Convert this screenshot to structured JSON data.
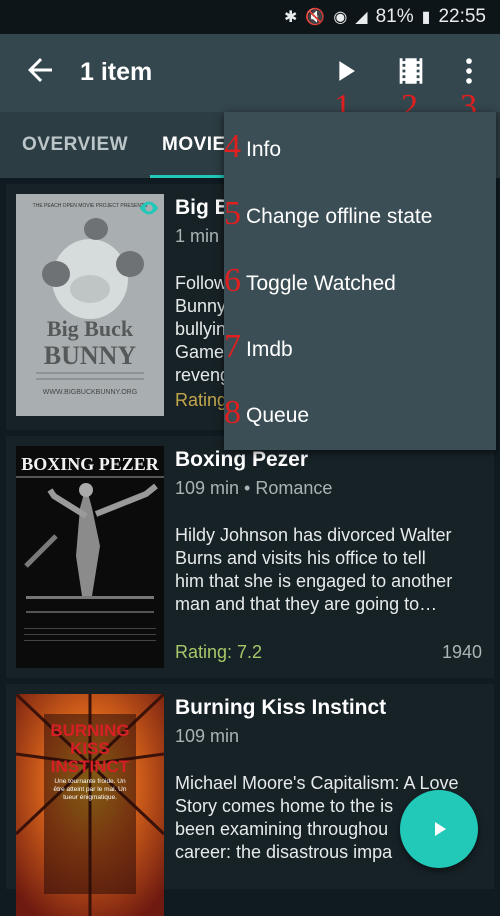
{
  "status_bar": {
    "battery": "81%",
    "time": "22:55",
    "icons": [
      "bluetooth-icon",
      "mute-icon",
      "wifi-icon",
      "signal-icon",
      "battery-icon"
    ]
  },
  "app_bar": {
    "title": "1 item",
    "actions": [
      {
        "icon": "play-icon",
        "number": "1"
      },
      {
        "icon": "film-icon",
        "number": "2"
      },
      {
        "icon": "more-vert-icon",
        "number": "3"
      }
    ]
  },
  "tabs": [
    {
      "label": "OVERVIEW",
      "active": false
    },
    {
      "label": "MOVIES",
      "active": true
    }
  ],
  "movies": [
    {
      "title": "Big Buck Bunny",
      "meta": "1 min",
      "desc_lines": [
        "Follow a day of the life of Big Buck",
        "Bunny when he meets three",
        "bullying rodents: Frank, Rinky, and",
        "Gamera. Bunny decides to take revenge."
      ],
      "rating": "Rating:",
      "year": "",
      "poster": {
        "top": "THE PEACH OPEN MOVIE PROJECT PRESENTS",
        "t1": "Big Buck",
        "t2": "BUNNY",
        "url": "WWW.BIGBUCKBUNNY.ORG"
      }
    },
    {
      "title": "Boxing Pezer",
      "meta": "109 min • Romance",
      "desc_lines": [
        "Hildy Johnson has divorced Walter",
        "Burns and visits his office to tell",
        "him that she is engaged to another",
        "man and that they are going to…"
      ],
      "rating": "Rating: 7.2",
      "year": "1940",
      "poster": {
        "t1": "BOXING PEZER"
      }
    },
    {
      "title": "Burning Kiss Instinct",
      "meta": "109 min",
      "desc_lines": [
        "Michael Moore's Capitalism: A Love",
        "Story comes home to the is",
        "been examining throughou",
        "career: the disastrous impa"
      ],
      "poster": {
        "t1": "BURNING",
        "t2": "KISS",
        "t3": "INSTINCT",
        "tag": "Une tournante froide. Un être atteint par le mal. Un tueur énigmatique."
      }
    }
  ],
  "menu": [
    {
      "number": "4",
      "label": "Info"
    },
    {
      "number": "5",
      "label": "Change offline state"
    },
    {
      "number": "6",
      "label": "Toggle Watched"
    },
    {
      "number": "7",
      "label": "Imdb"
    },
    {
      "number": "8",
      "label": "Queue"
    }
  ],
  "colors": {
    "accent": "#22c8b8",
    "app_bar": "#34474e",
    "annotation": "#e11f1f",
    "rating": "#a7c769"
  }
}
